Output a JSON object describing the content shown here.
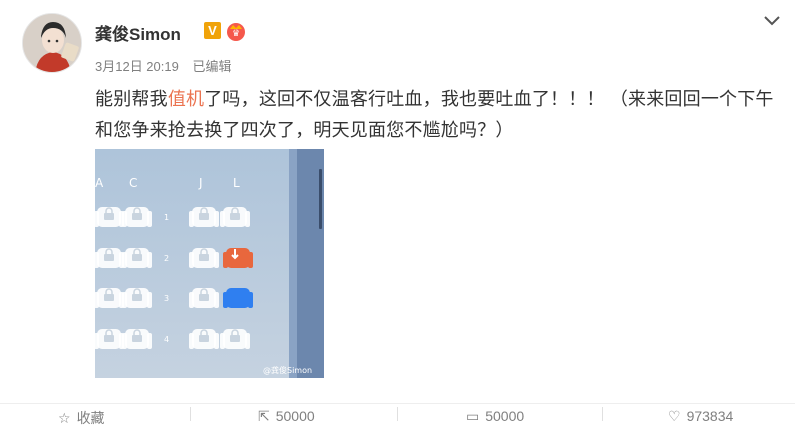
{
  "user": {
    "name": "龚俊Simon",
    "verified_badge": "V"
  },
  "meta": {
    "time": "3月12日 20:19",
    "edited": "已编辑"
  },
  "post": {
    "text_before": "能别帮我",
    "link_text": "值机",
    "text_after": "了吗，这回不仅温客行吐血，我也要吐血了！！！ （来来回回一个下午和您争来抢去换了四次了，明天见面您不尴尬吗？）"
  },
  "photo": {
    "seat_columns": [
      "A",
      "C",
      "J",
      "L"
    ],
    "row_numbers": [
      "1",
      "2",
      "3",
      "4"
    ],
    "watermark": "@龚俊Simon",
    "colors": {
      "background": "#b6cadd",
      "seat": "#ffffff",
      "seat_taken": "#e8673d",
      "seat_selected": "#2f7ff0"
    }
  },
  "actions": {
    "favorite": "收藏",
    "share_count": "50000",
    "comment_count": "50000",
    "like_count": "973834"
  },
  "colors": {
    "link": "#eb7350",
    "meta_text": "#808080"
  }
}
